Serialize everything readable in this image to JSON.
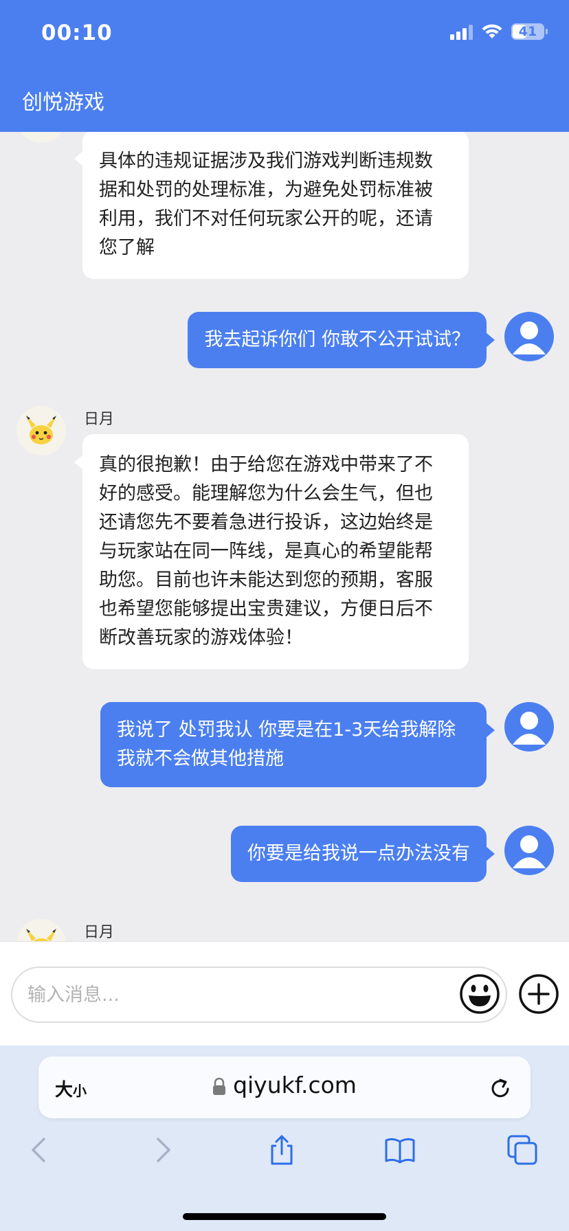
{
  "status": {
    "time": "00:10",
    "battery": "41"
  },
  "app": {
    "title": "创悦游戏"
  },
  "messages": [
    {
      "from": "agent",
      "name": "",
      "text": "具体的违规证据涉及我们游戏判断违规数据和处罚的处理标准，为避免处罚标准被利用，我们不对任何玩家公开的呢，还请您了解"
    },
    {
      "from": "user",
      "text": "我去起诉你们 你敢不公开试试？"
    },
    {
      "from": "agent",
      "name": "日月",
      "text": "真的很抱歉！由于给您在游戏中带来了不好的感受。能理解您为什么会生气，但也还请您先不要着急进行投诉，这边始终是与玩家站在同一阵线，是真心的希望能帮助您。目前也许未能达到您的预期，客服也希望您能够提出宝贵建议，方便日后不断改善玩家的游戏体验！"
    },
    {
      "from": "user",
      "text": "我说了 处罚我认 你要是在1-3天给我解除我就不会做其他措施"
    },
    {
      "from": "user",
      "text": "你要是给我说一点办法没有"
    },
    {
      "from": "agent",
      "name": "日月",
      "text": ""
    }
  ],
  "composer": {
    "placeholder": "输入消息..."
  },
  "browser": {
    "text_size_label": "大",
    "text_size_small": "小",
    "url": "qiyukf.com"
  }
}
